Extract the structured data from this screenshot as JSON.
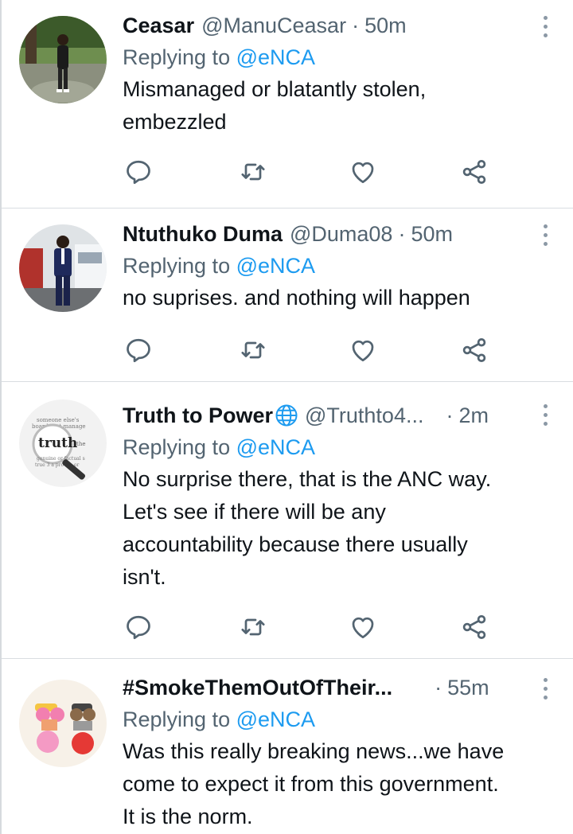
{
  "tweets": [
    {
      "name": "Ceasar",
      "handle": "@ManuCeasar",
      "separator": "·",
      "time": "50m",
      "replying_prefix": "Replying to ",
      "replying_to": "@eNCA",
      "text_lines": [
        "Mismanaged or blatantly stolen,",
        "embezzled"
      ]
    },
    {
      "name": "Ntuthuko Duma",
      "handle": "@Duma08",
      "separator": "·",
      "time": "50m",
      "replying_prefix": "Replying to ",
      "replying_to": "@eNCA",
      "text_lines": [
        "no suprises. and nothing will happen"
      ]
    },
    {
      "name": "Truth to Power",
      "handle": "@Truthto4...",
      "separator": "·",
      "time": "2m",
      "replying_prefix": "Replying to ",
      "replying_to": "@eNCA",
      "text_lines": [
        "No surprise there, that is the ANC way.",
        "Let's see if there will be any",
        "accountability because there usually",
        "isn't."
      ]
    },
    {
      "name": "#SmokeThemOutOfTheir...",
      "handle": "",
      "separator": "·",
      "time": "55m",
      "replying_prefix": "Replying to ",
      "replying_to": "@eNCA",
      "text_lines": [
        "Was this really breaking news...we have",
        "come to expect it from this government.",
        "It is the norm."
      ]
    }
  ],
  "avatar3_text": {
    "line1": "someone else's",
    "line2": "board that manage",
    "word": "truth",
    "tag": "the",
    "line3": "genuine or factual s",
    "line4": "true 3 a proven or"
  },
  "colors": {
    "text": "#0f1419",
    "secondary": "#536471",
    "link": "#1d9bf0",
    "icon": "#536471",
    "divider": "#d9dde1"
  },
  "icons": [
    "reply-icon",
    "retweet-icon",
    "like-icon",
    "share-icon",
    "more-icon",
    "globe-icon"
  ]
}
